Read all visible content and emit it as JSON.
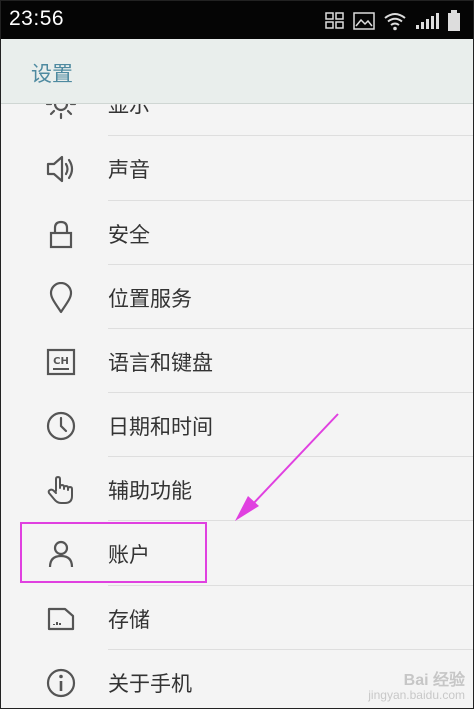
{
  "status_bar": {
    "time": "23:56",
    "icons": [
      "app-grid-icon",
      "image-icon",
      "wifi-icon",
      "signal-icon",
      "battery-icon"
    ]
  },
  "header": {
    "title": "设置"
  },
  "settings": {
    "items": [
      {
        "label": "显示",
        "icon": "brightness-icon"
      },
      {
        "label": "声音",
        "icon": "speaker-icon"
      },
      {
        "label": "安全",
        "icon": "lock-icon"
      },
      {
        "label": "位置服务",
        "icon": "location-pin-icon"
      },
      {
        "label": "语言和键盘",
        "icon": "keyboard-ch-icon"
      },
      {
        "label": "日期和时间",
        "icon": "clock-icon"
      },
      {
        "label": "辅助功能",
        "icon": "hand-pointer-icon"
      },
      {
        "label": "账户",
        "icon": "person-icon"
      },
      {
        "label": "存储",
        "icon": "sd-card-icon"
      },
      {
        "label": "关于手机",
        "icon": "info-icon"
      }
    ]
  },
  "annotation": {
    "color": "#e040e0",
    "highlighted_item": "账户"
  },
  "watermark": {
    "brand": "Bai 经验",
    "site": "jingyan.baidu.com"
  }
}
